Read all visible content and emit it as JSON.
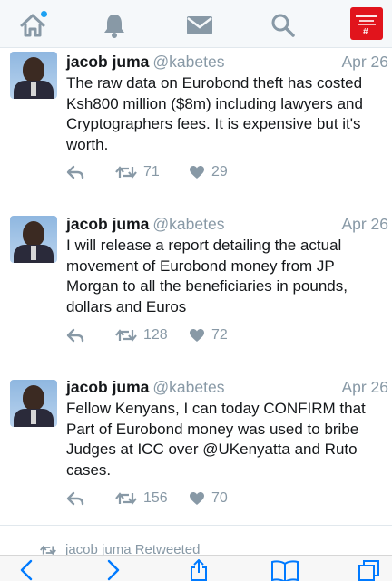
{
  "nav": {
    "home_icon": "home-icon",
    "notifications_icon": "bell-icon",
    "messages_icon": "envelope-icon",
    "search_icon": "search-icon",
    "accent": "#1da1f2",
    "profile_bg": "#e1141c"
  },
  "tweets": [
    {
      "name": "jacob juma",
      "handle": "@kabetes",
      "date": "Apr 26",
      "text": "The raw data on Eurobond theft has costed Ksh800 million ($8m) including lawyers and Cryptographers fees. It is expensive but it's worth.",
      "retweets": "71",
      "likes": "29"
    },
    {
      "name": "jacob juma",
      "handle": "@kabetes",
      "date": "Apr 26",
      "text": "I will release a report detailing the actual movement of Eurobond money from JP Morgan to all the beneficiaries in pounds, dollars and Euros",
      "retweets": "128",
      "likes": "72"
    },
    {
      "name": "jacob juma",
      "handle": "@kabetes",
      "date": "Apr 26",
      "text": "Fellow Kenyans, I can today CONFIRM that Part of Eurobond money was used to bribe Judges at ICC over @UKenyatta and Ruto cases.",
      "retweets": "156",
      "likes": "70"
    }
  ],
  "retweet_context": {
    "label": "jacob juma Retweeted"
  },
  "browser": {
    "tint": "#007aff"
  }
}
